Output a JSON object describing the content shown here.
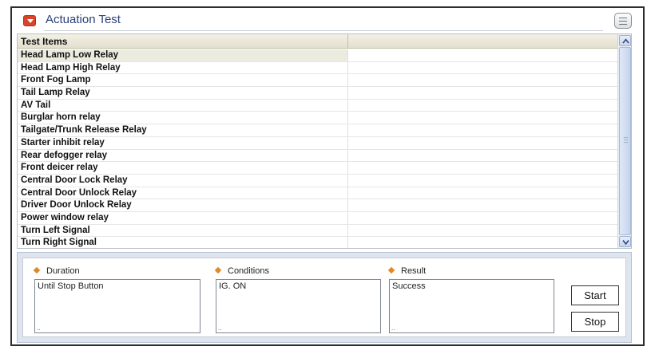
{
  "window": {
    "title": "Actuation Test"
  },
  "table": {
    "columns": [
      "Test Items",
      ""
    ],
    "rows": [
      "Head Lamp Low Relay",
      "Head Lamp High Relay",
      "Front Fog Lamp",
      "Tail Lamp Relay",
      "AV Tail",
      "Burglar horn relay",
      "Tailgate/Trunk Release Relay",
      "Starter inhibit relay",
      "Rear defogger relay",
      "Front deicer relay",
      "Central Door Lock Relay",
      "Central Door Unlock Relay",
      "Driver Door Unlock Relay",
      "Power window relay",
      "Turn Left Signal",
      "Turn Right Signal"
    ],
    "selected_row": "Head Lamp Low Relay"
  },
  "panel": {
    "duration": {
      "label": "Duration",
      "value": "Until Stop Button"
    },
    "conditions": {
      "label": "Conditions",
      "value": "IG. ON"
    },
    "result": {
      "label": "Result",
      "value": "Success"
    },
    "start_label": "Start",
    "stop_label": "Stop"
  },
  "colors": {
    "title_text": "#2a3f7a",
    "title_icon": "#d9442b",
    "bullet": "#e0892a",
    "panel_bg": "#dfe5ef"
  },
  "icons": {
    "title_icon": "collapse-arrow-icon",
    "title_menu": "menu-icon",
    "scroll_up": "arrow-up-icon",
    "scroll_down": "arrow-down-icon"
  }
}
